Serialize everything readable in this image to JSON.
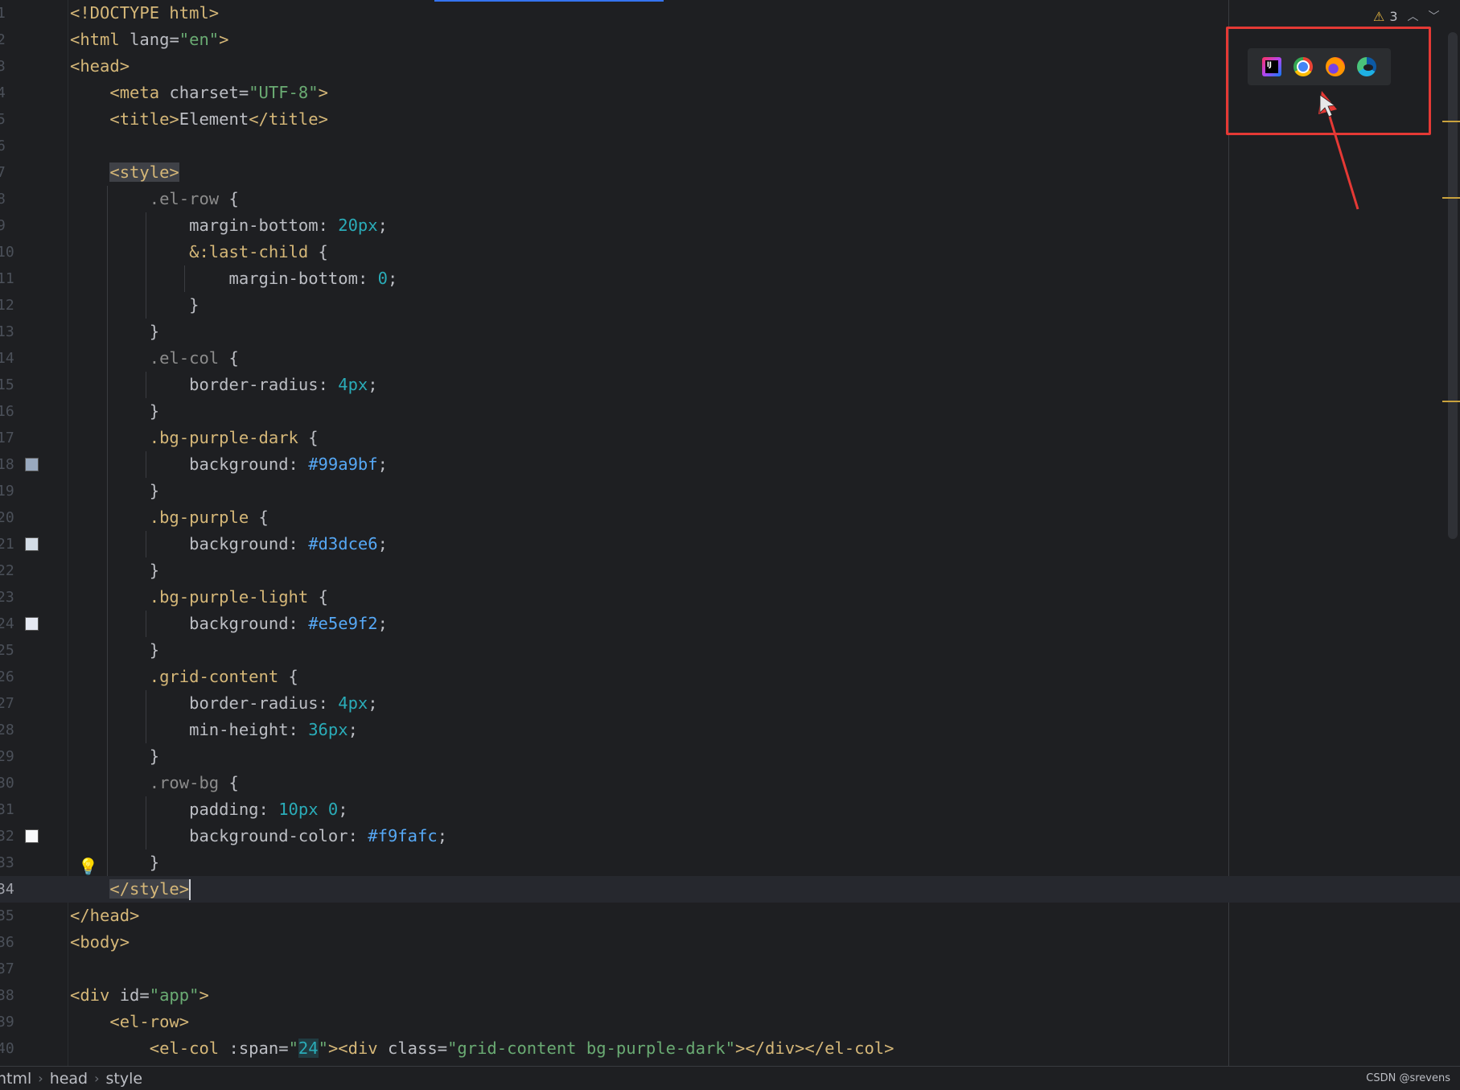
{
  "editor": {
    "current_line": 34,
    "lines": [
      {
        "n": "1",
        "tokens": [
          [
            "t-tag",
            "<!DOCTYPE html>"
          ]
        ]
      },
      {
        "n": "2",
        "tokens": [
          [
            "t-tag",
            "<html "
          ],
          [
            "t-attr",
            "lang"
          ],
          [
            "t-punc",
            "="
          ],
          [
            "t-str",
            "\"en\""
          ],
          [
            "t-tag",
            ">"
          ]
        ]
      },
      {
        "n": "3",
        "tokens": [
          [
            "t-tag",
            "<head>"
          ]
        ]
      },
      {
        "n": "4",
        "tokens": [
          [
            "",
            "    "
          ],
          [
            "t-tag",
            "<meta "
          ],
          [
            "t-attr",
            "charset"
          ],
          [
            "t-punc",
            "="
          ],
          [
            "t-str",
            "\"UTF-8\""
          ],
          [
            "t-tag",
            ">"
          ]
        ]
      },
      {
        "n": "5",
        "tokens": [
          [
            "",
            "    "
          ],
          [
            "t-tag",
            "<title>"
          ],
          [
            "t-punc",
            "Element"
          ],
          [
            "t-tag",
            "</title>"
          ]
        ]
      },
      {
        "n": "6",
        "tokens": []
      },
      {
        "n": "7",
        "tokens": [
          [
            "",
            "    "
          ],
          [
            "t-tag t-hl",
            "<style>"
          ]
        ]
      },
      {
        "n": "8",
        "tokens": [
          [
            "",
            "        "
          ],
          [
            "t-sel",
            ".el-row"
          ],
          [
            "t-punc",
            " {"
          ]
        ]
      },
      {
        "n": "9",
        "tokens": [
          [
            "",
            "            "
          ],
          [
            "t-prop",
            "margin-bottom"
          ],
          [
            "t-punc",
            ": "
          ],
          [
            "t-num",
            "20px"
          ],
          [
            "t-punc",
            ";"
          ]
        ]
      },
      {
        "n": "10",
        "tokens": [
          [
            "",
            "            "
          ],
          [
            "t-selcls",
            "&:last-child"
          ],
          [
            "t-punc",
            " {"
          ]
        ]
      },
      {
        "n": "11",
        "tokens": [
          [
            "",
            "                "
          ],
          [
            "t-prop",
            "margin-bottom"
          ],
          [
            "t-punc",
            ": "
          ],
          [
            "t-num",
            "0"
          ],
          [
            "t-punc",
            ";"
          ]
        ]
      },
      {
        "n": "12",
        "tokens": [
          [
            "",
            "            "
          ],
          [
            "t-punc",
            "}"
          ]
        ]
      },
      {
        "n": "13",
        "tokens": [
          [
            "",
            "        "
          ],
          [
            "t-punc",
            "}"
          ]
        ]
      },
      {
        "n": "14",
        "tokens": [
          [
            "",
            "        "
          ],
          [
            "t-sel",
            ".el-col"
          ],
          [
            "t-punc",
            " {"
          ]
        ]
      },
      {
        "n": "15",
        "tokens": [
          [
            "",
            "            "
          ],
          [
            "t-prop",
            "border-radius"
          ],
          [
            "t-punc",
            ": "
          ],
          [
            "t-num",
            "4px"
          ],
          [
            "t-punc",
            ";"
          ]
        ]
      },
      {
        "n": "16",
        "tokens": [
          [
            "",
            "        "
          ],
          [
            "t-punc",
            "}"
          ]
        ]
      },
      {
        "n": "17",
        "tokens": [
          [
            "",
            "        "
          ],
          [
            "t-selcls",
            ".bg-purple-dark"
          ],
          [
            "t-punc",
            " {"
          ]
        ]
      },
      {
        "n": "18",
        "swatch": "#99a9bf",
        "tokens": [
          [
            "",
            "            "
          ],
          [
            "t-prop",
            "background"
          ],
          [
            "t-punc",
            ": "
          ],
          [
            "t-hex",
            "#99a9bf"
          ],
          [
            "t-punc",
            ";"
          ]
        ]
      },
      {
        "n": "19",
        "tokens": [
          [
            "",
            "        "
          ],
          [
            "t-punc",
            "}"
          ]
        ]
      },
      {
        "n": "20",
        "tokens": [
          [
            "",
            "        "
          ],
          [
            "t-selcls",
            ".bg-purple"
          ],
          [
            "t-punc",
            " {"
          ]
        ]
      },
      {
        "n": "21",
        "swatch": "#d3dce6",
        "tokens": [
          [
            "",
            "            "
          ],
          [
            "t-prop",
            "background"
          ],
          [
            "t-punc",
            ": "
          ],
          [
            "t-hex",
            "#d3dce6"
          ],
          [
            "t-punc",
            ";"
          ]
        ]
      },
      {
        "n": "22",
        "tokens": [
          [
            "",
            "        "
          ],
          [
            "t-punc",
            "}"
          ]
        ]
      },
      {
        "n": "23",
        "tokens": [
          [
            "",
            "        "
          ],
          [
            "t-selcls",
            ".bg-purple-light"
          ],
          [
            "t-punc",
            " {"
          ]
        ]
      },
      {
        "n": "24",
        "swatch": "#e5e9f2",
        "tokens": [
          [
            "",
            "            "
          ],
          [
            "t-prop",
            "background"
          ],
          [
            "t-punc",
            ": "
          ],
          [
            "t-hex",
            "#e5e9f2"
          ],
          [
            "t-punc",
            ";"
          ]
        ]
      },
      {
        "n": "25",
        "tokens": [
          [
            "",
            "        "
          ],
          [
            "t-punc",
            "}"
          ]
        ]
      },
      {
        "n": "26",
        "tokens": [
          [
            "",
            "        "
          ],
          [
            "t-selcls",
            ".grid-content"
          ],
          [
            "t-punc",
            " {"
          ]
        ]
      },
      {
        "n": "27",
        "tokens": [
          [
            "",
            "            "
          ],
          [
            "t-prop",
            "border-radius"
          ],
          [
            "t-punc",
            ": "
          ],
          [
            "t-num",
            "4px"
          ],
          [
            "t-punc",
            ";"
          ]
        ]
      },
      {
        "n": "28",
        "tokens": [
          [
            "",
            "            "
          ],
          [
            "t-prop",
            "min-height"
          ],
          [
            "t-punc",
            ": "
          ],
          [
            "t-num",
            "36px"
          ],
          [
            "t-punc",
            ";"
          ]
        ]
      },
      {
        "n": "29",
        "tokens": [
          [
            "",
            "        "
          ],
          [
            "t-punc",
            "}"
          ]
        ]
      },
      {
        "n": "30",
        "tokens": [
          [
            "",
            "        "
          ],
          [
            "t-sel",
            ".row-bg"
          ],
          [
            "t-punc",
            " {"
          ]
        ]
      },
      {
        "n": "31",
        "tokens": [
          [
            "",
            "            "
          ],
          [
            "t-prop",
            "padding"
          ],
          [
            "t-punc",
            ": "
          ],
          [
            "t-num",
            "10px 0"
          ],
          [
            "t-punc",
            ";"
          ]
        ]
      },
      {
        "n": "32",
        "swatch": "#f9fafc",
        "tokens": [
          [
            "",
            "            "
          ],
          [
            "t-prop",
            "background-color"
          ],
          [
            "t-punc",
            ": "
          ],
          [
            "t-hex",
            "#f9fafc"
          ],
          [
            "t-punc",
            ";"
          ]
        ]
      },
      {
        "n": "33",
        "bulb": true,
        "tokens": [
          [
            "",
            "        "
          ],
          [
            "t-punc",
            "}"
          ]
        ]
      },
      {
        "n": "34",
        "caret": true,
        "tokens": [
          [
            "",
            "    "
          ],
          [
            "t-tag t-hl",
            "</style>"
          ]
        ]
      },
      {
        "n": "35",
        "tokens": [
          [
            "t-tag",
            "</head>"
          ]
        ]
      },
      {
        "n": "36",
        "tokens": [
          [
            "t-tag",
            "<body>"
          ]
        ]
      },
      {
        "n": "37",
        "tokens": []
      },
      {
        "n": "38",
        "tokens": [
          [
            "t-tag",
            "<div "
          ],
          [
            "t-attr",
            "id"
          ],
          [
            "t-punc",
            "="
          ],
          [
            "t-str",
            "\"app\""
          ],
          [
            "t-tag",
            ">"
          ]
        ]
      },
      {
        "n": "39",
        "tokens": [
          [
            "",
            "    "
          ],
          [
            "t-comp",
            "<el-row>"
          ]
        ]
      },
      {
        "n": "40",
        "tokens": [
          [
            "",
            "        "
          ],
          [
            "t-comp",
            "<el-col "
          ],
          [
            "t-attr",
            ":span"
          ],
          [
            "t-punc",
            "="
          ],
          [
            "t-str",
            "\""
          ],
          [
            "t-hlnum",
            "24"
          ],
          [
            "t-str",
            "\""
          ],
          [
            "t-tag",
            "><div "
          ],
          [
            "t-attr",
            "class"
          ],
          [
            "t-punc",
            "="
          ],
          [
            "t-str",
            "\"grid-content bg-purple-dark\""
          ],
          [
            "t-tag",
            "></div>"
          ],
          [
            "t-comp",
            "</el-col>"
          ]
        ]
      }
    ]
  },
  "inspection": {
    "warning_count": "3",
    "warning_icon": "warning-triangle-icon",
    "prev_icon": "chevron-up-icon",
    "next_icon": "chevron-down-icon"
  },
  "browser_popup": {
    "browsers": [
      "IntelliJ built-in preview",
      "Chrome",
      "Firefox",
      "Edge"
    ]
  },
  "breadcrumb": [
    "html",
    "head",
    "style"
  ],
  "watermark": "CSDN @srevens",
  "colors": {
    "background": "#1e1f22",
    "annotation": "#e53935"
  }
}
